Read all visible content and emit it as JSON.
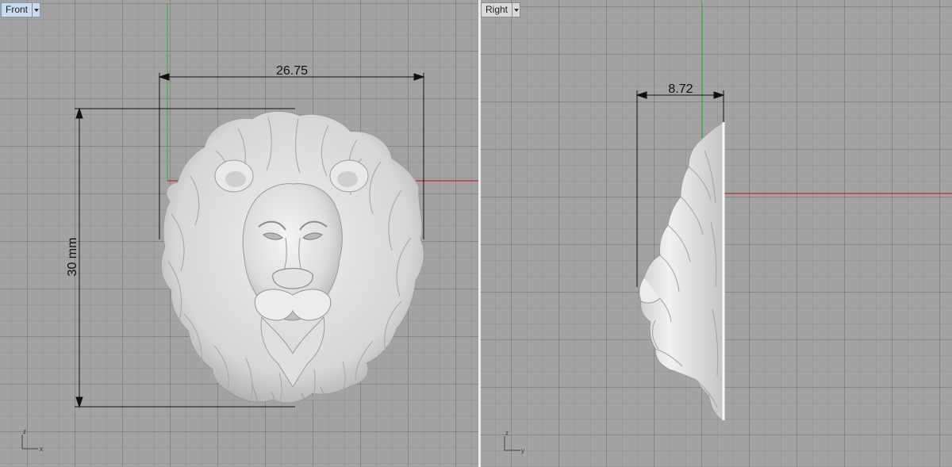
{
  "viewports": {
    "front": {
      "label": "Front",
      "dimension_width": "26.75",
      "dimension_height": "30 mm",
      "axis_vertical": "z",
      "axis_horizontal": "x",
      "model": "lion-head-front"
    },
    "right": {
      "label": "Right",
      "dimension_depth": "8.72",
      "axis_vertical": "z",
      "axis_horizontal": "y",
      "model": "lion-head-side"
    }
  },
  "colors": {
    "viewport_bg": "#a3a3a3",
    "grid": "#787878",
    "x_axis": "#c0282d",
    "y_axis": "#3cb043",
    "active_tab": "#c9dcef",
    "model": "#e6e6e6"
  },
  "icons": {
    "dropdown": "chevron-down-icon",
    "axis_widget": "axis-gizmo-icon"
  }
}
